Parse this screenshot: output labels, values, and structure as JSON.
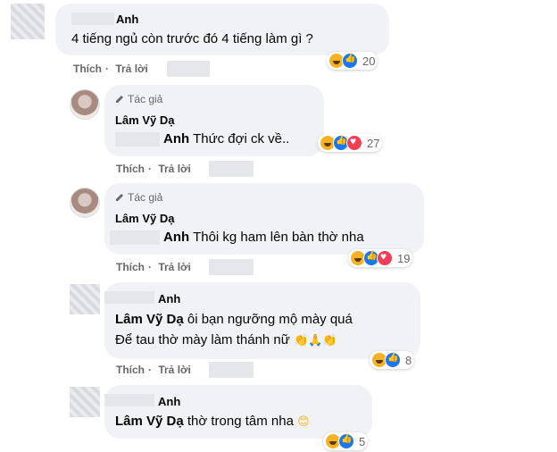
{
  "comments": [
    {
      "name": "Anh",
      "text": "4 tiếng ngủ còn trước đó 4 tiếng làm gì ?",
      "like": "Thích",
      "reply": "Trả lời",
      "reaction_count": "20"
    },
    {
      "badge": "Tác giả",
      "name": "Lâm Vỹ Dạ",
      "tag": "Anh",
      "text": "Thức đợi ck về..",
      "like": "Thích",
      "reply": "Trả lời",
      "reaction_count": "27"
    },
    {
      "badge": "Tác giả",
      "name": "Lâm Vỹ Dạ",
      "tag": "Anh",
      "text": "Thôi kg ham lên bàn thờ nha",
      "like": "Thích",
      "reply": "Trả lời",
      "reaction_count": "19"
    },
    {
      "name": "Anh",
      "tag": "Lâm Vỹ Dạ",
      "text": "ôi bạn ngưỡng mộ mày quá",
      "text2": "Để tau thờ mày làm thánh nữ",
      "like": "Thích",
      "reply": "Trả lời",
      "reaction_count": "8"
    },
    {
      "name": "Anh",
      "tag": "Lâm Vỹ Dạ",
      "text": "thờ trong tâm nha",
      "reaction_count": "5"
    }
  ]
}
